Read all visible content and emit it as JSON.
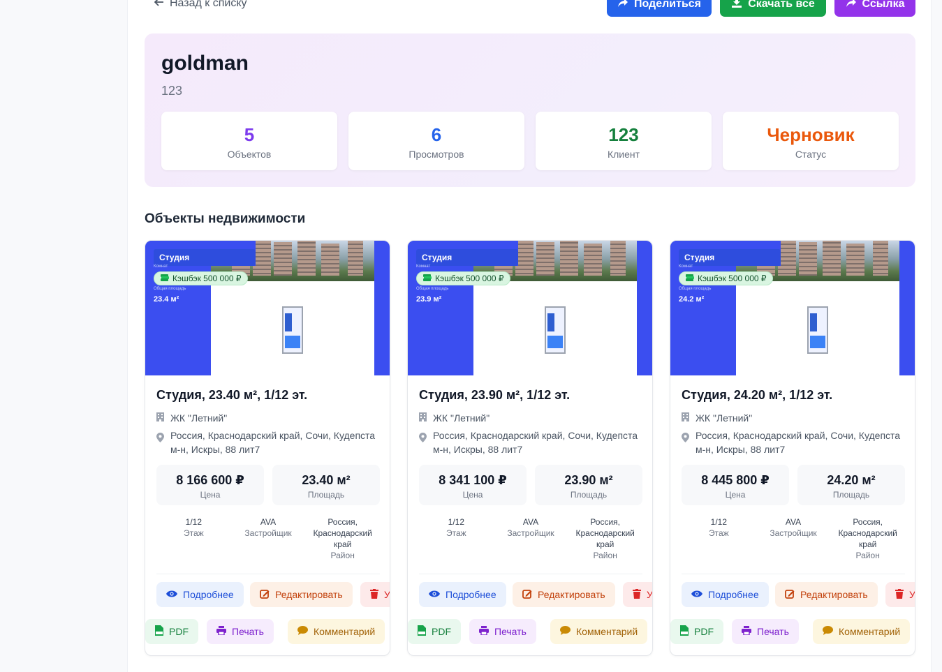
{
  "topbar": {
    "back_label": "Назад к списку",
    "share_label": "Поделиться",
    "download_label": "Скачать все",
    "link_label": "Ссылка"
  },
  "collection": {
    "title": "goldman",
    "subtitle": "123"
  },
  "stats": [
    {
      "value": "5",
      "label": "Объектов",
      "color": "#7c3aed"
    },
    {
      "value": "6",
      "label": "Просмотров",
      "color": "#2563eb"
    },
    {
      "value": "123",
      "label": "Клиент",
      "color": "#15803d"
    },
    {
      "value": "Черновик",
      "label": "Статус",
      "color": "#ea580c"
    }
  ],
  "section_title": "Объекты недвижимости",
  "cards": [
    {
      "image": {
        "tag": "Студия",
        "tiny_rooms": "Комнат",
        "cashback": "Кэшбэк 500 000 ₽",
        "tiny_area": "Общая площадь",
        "area": "23.4 м²"
      },
      "title": "Студия, 23.40 м², 1/12 эт.",
      "complex": "ЖК \"Летний\"",
      "address": "Россия, Краснодарский край, Сочи, Кудепста м-н, Искры, 88 лит7",
      "price": "8 166 600 ₽",
      "price_label": "Цена",
      "area": "23.40 м²",
      "area_label": "Площадь",
      "floor": "1/12",
      "floor_label": "Этаж",
      "developer": "AVA",
      "developer_label": "Застройщик",
      "region": "Россия, Краснодарский край",
      "region_label": "Район",
      "actions": {
        "more": "Подробнее",
        "edit": "Редактировать",
        "delete": "У",
        "pdf": "PDF",
        "print": "Печать",
        "comment": "Комментарий"
      }
    },
    {
      "image": {
        "tag": "Студия",
        "tiny_rooms": "Комнат",
        "cashback": "Кэшбэк 500 000 ₽",
        "tiny_area": "Общая площадь",
        "area": "23.9 м²"
      },
      "title": "Студия, 23.90 м², 1/12 эт.",
      "complex": "ЖК \"Летний\"",
      "address": "Россия, Краснодарский край, Сочи, Кудепста м-н, Искры, 88 лит7",
      "price": "8 341 100 ₽",
      "price_label": "Цена",
      "area": "23.90 м²",
      "area_label": "Площадь",
      "floor": "1/12",
      "floor_label": "Этаж",
      "developer": "AVA",
      "developer_label": "Застройщик",
      "region": "Россия, Краснодарский край",
      "region_label": "Район",
      "actions": {
        "more": "Подробнее",
        "edit": "Редактировать",
        "delete": "У",
        "pdf": "PDF",
        "print": "Печать",
        "comment": "Комментарий"
      }
    },
    {
      "image": {
        "tag": "Студия",
        "tiny_rooms": "Комнат",
        "cashback": "Кэшбэк 500 000 ₽",
        "tiny_area": "Общая площадь",
        "area": "24.2 м²"
      },
      "title": "Студия, 24.20 м², 1/12 эт.",
      "complex": "ЖК \"Летний\"",
      "address": "Россия, Краснодарский край, Сочи, Кудепста м-н, Искры, 88 лит7",
      "price": "8 445 800 ₽",
      "price_label": "Цена",
      "area": "24.20 м²",
      "area_label": "Площадь",
      "floor": "1/12",
      "floor_label": "Этаж",
      "developer": "AVA",
      "developer_label": "Застройщик",
      "region": "Россия, Краснодарский край",
      "region_label": "Район",
      "actions": {
        "more": "Подробнее",
        "edit": "Редактировать",
        "delete": "У",
        "pdf": "PDF",
        "print": "Печать",
        "comment": "Комментарий"
      }
    }
  ],
  "icons": {
    "back": "arrow-left-icon",
    "share": "share-icon",
    "download": "download-icon",
    "link": "link-icon",
    "building": "building-icon",
    "pin": "map-pin-icon",
    "eye": "eye-icon",
    "edit": "edit-icon",
    "trash": "trash-icon",
    "pdf": "pdf-file-icon",
    "print": "printer-icon",
    "comment": "comment-icon",
    "money": "money-icon"
  }
}
